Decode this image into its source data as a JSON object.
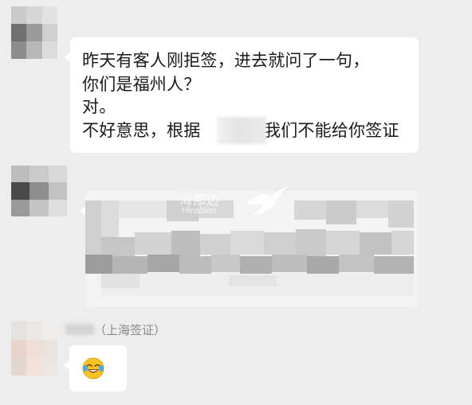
{
  "messages": [
    {
      "lines": [
        "昨天有客人刚拒签，进去就问了一句，",
        "你们是福州人？",
        "对。",
        "不好意思，根据",
        "我们不能给你签证"
      ]
    },
    {
      "watermark": {
        "zh": "海那边",
        "en": "Hinabian"
      }
    },
    {
      "sender_suffix": "（上海签证）",
      "emoji": "laughing-crying-emoji"
    }
  ],
  "colors": {
    "background": "#ededed",
    "bubble": "#ffffff",
    "text": "#1a1a1a",
    "sender_text": "#8a8a8a",
    "emoji_yellow": "#f7c325"
  }
}
